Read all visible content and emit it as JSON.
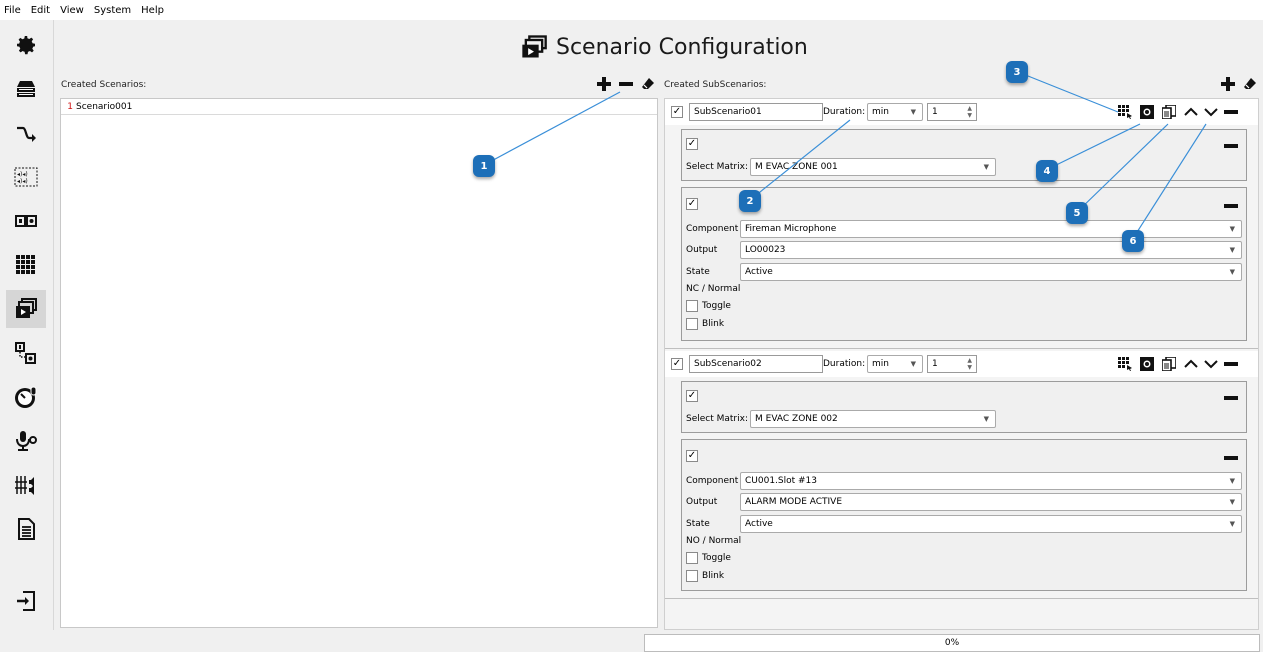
{
  "menu": [
    "File",
    "Edit",
    "View",
    "System",
    "Help"
  ],
  "title": "Scenario Configuration",
  "scenarios": {
    "label": "Created Scenarios:",
    "items": [
      {
        "num": "1",
        "name": "Scenario001"
      }
    ]
  },
  "subscenarios": {
    "label": "Created SubScenarios:",
    "list": [
      {
        "name": "SubScenario01",
        "duration_label": "Duration:",
        "duration_unit": "min",
        "duration_value": "1",
        "matrix_label": "Select Matrix:",
        "matrix_value": "M EVAC ZONE 001",
        "component_label": "Component",
        "component_value": "Fireman Microphone",
        "output_label": "Output",
        "output_value": "LO00023",
        "state_label": "State",
        "state_value": "Active",
        "mode_text": "NC / Normal",
        "toggle_label": "Toggle",
        "blink_label": "Blink"
      },
      {
        "name": "SubScenario02",
        "duration_label": "Duration:",
        "duration_unit": "min",
        "duration_value": "1",
        "matrix_label": "Select Matrix:",
        "matrix_value": "M EVAC ZONE 002",
        "component_label": "Component",
        "component_value": "CU001.Slot #13",
        "output_label": "Output",
        "output_value": "ALARM MODE ACTIVE",
        "state_label": "State",
        "state_value": "Active",
        "mode_text": "NO / Normal",
        "toggle_label": "Toggle",
        "blink_label": "Blink"
      }
    ]
  },
  "badges": [
    "1",
    "2",
    "3",
    "4",
    "5",
    "6"
  ],
  "progress": "0%",
  "colors": {
    "badge": "#1d6fb8",
    "callout_line": "#3a8fd8",
    "scenario_num": "#d01010"
  },
  "sidebar_icons": [
    "gear-icon",
    "server-icon",
    "route-icon",
    "speaker-group-icon",
    "io-icon",
    "matrix-grid-icon",
    "scenario-icon",
    "io-link-icon",
    "gauge-icon",
    "mic-settings-icon",
    "mixer-icon",
    "document-icon",
    "logout-icon"
  ]
}
